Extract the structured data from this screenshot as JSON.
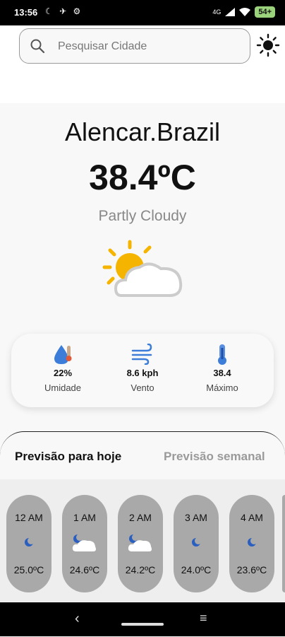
{
  "status_bar": {
    "time": "13:56",
    "network": "4G",
    "battery": "54+"
  },
  "search": {
    "placeholder": "Pesquisar Cidade",
    "value": ""
  },
  "icons": {
    "search": "search-icon",
    "theme": "sun-icon",
    "weather": "partly-cloudy-icon",
    "humidity": "humidity-icon",
    "wind": "wind-icon",
    "thermometer": "thermometer-icon"
  },
  "weather": {
    "location": "Alencar.Brazil",
    "temperature": "38.4ºC",
    "condition": "Partly Cloudy"
  },
  "stats": [
    {
      "value": "22%",
      "label": "Umidade"
    },
    {
      "value": "8.6 kph",
      "label": "Vento"
    },
    {
      "value": "38.4",
      "label": "Máximo"
    }
  ],
  "tabs": {
    "today": "Previsão para hoje",
    "week": "Previsão semanal"
  },
  "hourly": [
    {
      "time": "12 AM",
      "icon": "moon-icon",
      "temp": "25.0ºC"
    },
    {
      "time": "1 AM",
      "icon": "moon-cloud-icon",
      "temp": "24.6ºC"
    },
    {
      "time": "2 AM",
      "icon": "moon-cloud-icon",
      "temp": "24.2ºC"
    },
    {
      "time": "3 AM",
      "icon": "moon-icon",
      "temp": "24.0ºC"
    },
    {
      "time": "4 AM",
      "icon": "moon-icon",
      "temp": "23.6ºC"
    }
  ],
  "colors": {
    "background": "#f8f8f8",
    "card_gray": "#a9a9a9",
    "accent_blue": "#3b7dd8",
    "sun_yellow": "#f5b400"
  }
}
